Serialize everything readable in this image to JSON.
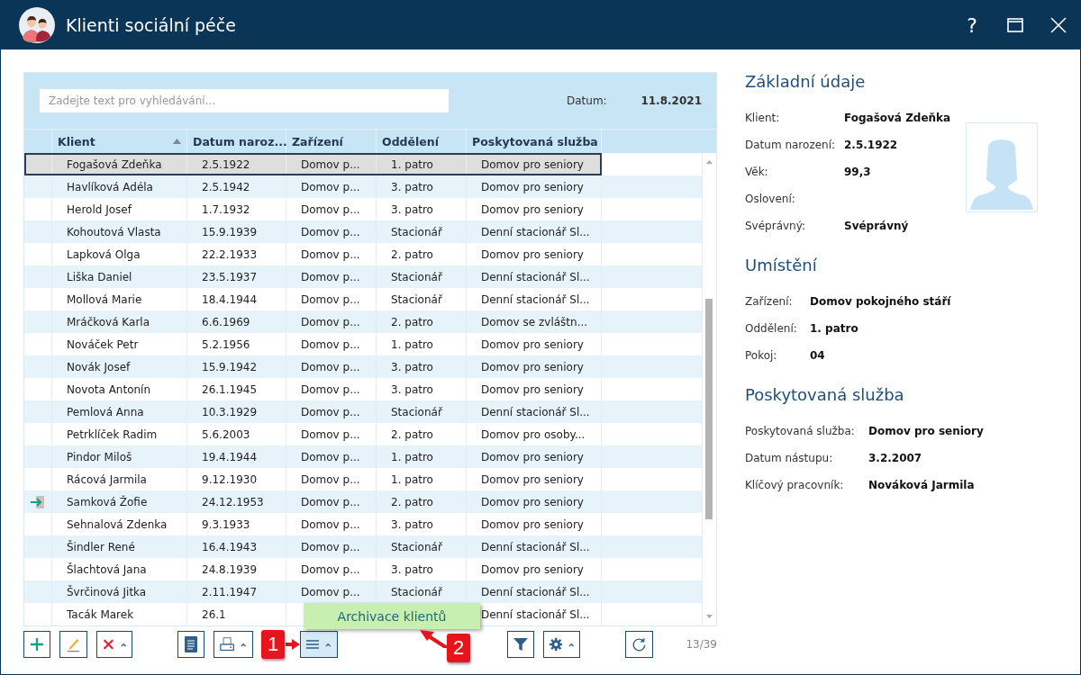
{
  "window": {
    "title": "Klienti sociální péče",
    "help": "?"
  },
  "search": {
    "placeholder": "Zadejte text pro vyhledávání...",
    "date_label": "Datum:",
    "date_value": "11.8.2021"
  },
  "table": {
    "columns": [
      {
        "label": "Klient",
        "sorted": true
      },
      {
        "label": "Datum naroz..."
      },
      {
        "label": "Zařízení"
      },
      {
        "label": "Oddělení"
      },
      {
        "label": "Poskytovaná služba"
      }
    ],
    "rows": [
      {
        "cells": [
          "Fogašová Zdeňka",
          "2.5.1922",
          "Domov p...",
          "1. patro",
          "Domov pro seniory"
        ],
        "selected": true,
        "marker": false
      },
      {
        "cells": [
          "Havlíková Adéla",
          "2.5.1942",
          "Domov p...",
          "3. patro",
          "Domov pro seniory"
        ],
        "selected": false,
        "marker": false
      },
      {
        "cells": [
          "Herold Josef",
          "1.7.1932",
          "Domov p...",
          "3. patro",
          "Domov pro seniory"
        ],
        "selected": false,
        "marker": false
      },
      {
        "cells": [
          "Kohoutová Vlasta",
          "15.9.1939",
          "Domov p...",
          "Stacionář",
          "Denní stacionář Sl..."
        ],
        "selected": false,
        "marker": false
      },
      {
        "cells": [
          "Lapková Olga",
          "22.2.1933",
          "Domov p...",
          "2. patro",
          "Domov pro seniory"
        ],
        "selected": false,
        "marker": false
      },
      {
        "cells": [
          "Liška Daniel",
          "23.5.1937",
          "Domov p...",
          "Stacionář",
          "Denní stacionář Sl..."
        ],
        "selected": false,
        "marker": false
      },
      {
        "cells": [
          "Mollová Marie",
          "18.4.1944",
          "Domov p...",
          "Stacionář",
          "Denní stacionář Sl..."
        ],
        "selected": false,
        "marker": false
      },
      {
        "cells": [
          "Mráčková Karla",
          "6.6.1969",
          "Domov p...",
          "2. patro",
          "Domov se zvláštn..."
        ],
        "selected": false,
        "marker": false
      },
      {
        "cells": [
          "Nováček Petr",
          "5.2.1956",
          "Domov p...",
          "1. patro",
          "Domov pro seniory"
        ],
        "selected": false,
        "marker": false
      },
      {
        "cells": [
          "Novák Josef",
          "15.9.1942",
          "Domov p...",
          "3. patro",
          "Domov pro seniory"
        ],
        "selected": false,
        "marker": false
      },
      {
        "cells": [
          "Novota Antonín",
          "26.1.1945",
          "Domov p...",
          "3. patro",
          "Domov pro seniory"
        ],
        "selected": false,
        "marker": false
      },
      {
        "cells": [
          "Pemlová Anna",
          "10.3.1929",
          "Domov p...",
          "Stacionář",
          "Denní stacionář Sl..."
        ],
        "selected": false,
        "marker": false
      },
      {
        "cells": [
          "Petrklíček Radim",
          "5.6.2003",
          "Domov p...",
          "2. patro",
          "Domov pro osoby..."
        ],
        "selected": false,
        "marker": false
      },
      {
        "cells": [
          "Pindor Miloš",
          "19.4.1944",
          "Domov p...",
          "1. patro",
          "Domov pro seniory"
        ],
        "selected": false,
        "marker": false
      },
      {
        "cells": [
          "Rácová Jarmila",
          "9.12.1930",
          "Domov p...",
          "1. patro",
          "Domov pro seniory"
        ],
        "selected": false,
        "marker": false
      },
      {
        "cells": [
          "Samková Žofie",
          "24.12.1953",
          "Domov p...",
          "2. patro",
          "Domov pro seniory"
        ],
        "selected": false,
        "marker": true
      },
      {
        "cells": [
          "Sehnalová Zdenka",
          "9.3.1933",
          "Domov p...",
          "3. patro",
          "Domov pro seniory"
        ],
        "selected": false,
        "marker": false
      },
      {
        "cells": [
          "Šindler René",
          "16.4.1943",
          "Domov p...",
          "Stacionář",
          "Denní stacionář Sl..."
        ],
        "selected": false,
        "marker": false
      },
      {
        "cells": [
          "Šlachtová Jana",
          "24.8.1939",
          "Domov p...",
          "3. patro",
          "Domov pro seniory"
        ],
        "selected": false,
        "marker": false
      },
      {
        "cells": [
          "Švrčinová Jitka",
          "2.11.1947",
          "Domov p...",
          "Stacionář",
          "Denní stacionář Sl..."
        ],
        "selected": false,
        "marker": false
      },
      {
        "cells": [
          "Tacák Marek",
          "26.1",
          null,
          null,
          "Denní stacionář Sl..."
        ],
        "selected": false,
        "marker": false
      }
    ]
  },
  "toolbar": {
    "buttons": [
      {
        "kind": "add",
        "dropdown": false,
        "pressed": false
      },
      {
        "kind": "edit",
        "dropdown": false,
        "pressed": false
      },
      {
        "kind": "delete",
        "dropdown": true,
        "pressed": false
      },
      {
        "kind": "document",
        "dropdown": false,
        "pressed": false
      },
      {
        "kind": "print",
        "dropdown": true,
        "pressed": false
      },
      {
        "kind": "menu",
        "dropdown": true,
        "pressed": true
      },
      {
        "kind": "filter",
        "dropdown": false,
        "pressed": false
      },
      {
        "kind": "settings",
        "dropdown": true,
        "pressed": false
      },
      {
        "kind": "refresh",
        "dropdown": false,
        "pressed": false
      }
    ],
    "count": "13/39"
  },
  "popup_menu": {
    "items": [
      "Archivace klientů"
    ]
  },
  "annotations": [
    {
      "label": "1"
    },
    {
      "label": "2"
    }
  ],
  "detail": {
    "sections": [
      {
        "title": "Základní údaje",
        "photo": true,
        "fields": [
          {
            "label": "Klient:",
            "value": "Fogašová Zdeňka"
          },
          {
            "label": "Datum narození:",
            "value": "2.5.1922"
          },
          {
            "label": "Věk:",
            "value": "99,3"
          },
          {
            "label": "Oslovení:"
          },
          {
            "label": "Svéprávný:",
            "value": "Svéprávný"
          }
        ]
      },
      {
        "title": "Umístění",
        "fields": [
          {
            "label": "Zařízení:",
            "value": "Domov pokojného stáří"
          },
          {
            "label": "Oddělení:",
            "value": "1. patro"
          },
          {
            "label": "Pokoj:",
            "value": "04"
          }
        ]
      },
      {
        "title": "Poskytovaná služba",
        "fields": [
          {
            "label": "Poskytovaná služba:",
            "value": "Domov pro seniory"
          },
          {
            "label": "Datum nástupu:",
            "value": "3.2.2007"
          },
          {
            "label": "Klíčový pracovník:",
            "value": "Nováková Jarmila"
          }
        ]
      }
    ]
  }
}
